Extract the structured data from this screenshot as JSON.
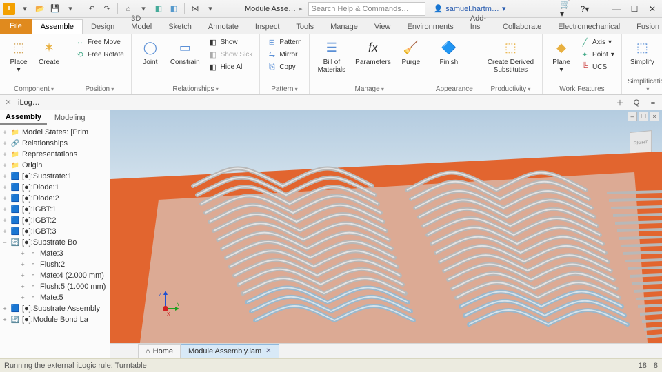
{
  "title": {
    "app_badge": "I",
    "doc": "Module Asse…",
    "search_placeholder": "Search Help & Commands…",
    "user": "samuel.hartm…"
  },
  "tabs": [
    "File",
    "Assemble",
    "Design",
    "3D Model",
    "Sketch",
    "Annotate",
    "Inspect",
    "Tools",
    "Manage",
    "View",
    "Environments",
    "Add-Ins",
    "Collaborate",
    "Electromechanical",
    "Fusion"
  ],
  "ribbon": {
    "component": {
      "title": "Component",
      "place": "Place",
      "create": "Create"
    },
    "position": {
      "title": "Position",
      "free_move": "Free Move",
      "free_rotate": "Free Rotate",
      "joint": "Joint",
      "constrain": "Constrain"
    },
    "relationships": {
      "title": "Relationships",
      "show": "Show",
      "show_sick": "Show Sick",
      "hide_all": "Hide All"
    },
    "pattern": {
      "title": "Pattern",
      "pattern": "Pattern",
      "mirror": "Mirror",
      "copy": "Copy"
    },
    "manage": {
      "title": "Manage",
      "bom": "Bill of\nMaterials",
      "params": "Parameters",
      "purge": "Purge"
    },
    "appearance": {
      "title": "Appearance",
      "finish": "Finish"
    },
    "productivity": {
      "title": "Productivity",
      "cds": "Create Derived\nSubstitutes"
    },
    "workfeat": {
      "title": "Work Features",
      "plane": "Plane",
      "axis": "Axis",
      "point": "Point",
      "ucs": "UCS"
    },
    "simplification": {
      "title": "Simplification",
      "simplify": "Simplify"
    }
  },
  "ilogic": {
    "label": "iLog…"
  },
  "browser": {
    "tabs": {
      "assembly": "Assembly",
      "modeling": "Modeling"
    },
    "items": [
      {
        "t": "Model States: [Prim",
        "k": "fold",
        "i": 0
      },
      {
        "t": "Relationships",
        "k": "rel",
        "i": 0
      },
      {
        "t": "Representations",
        "k": "fold",
        "i": 0
      },
      {
        "t": "Origin",
        "k": "fold",
        "i": 0
      },
      {
        "t": "[●]:Substrate:1",
        "k": "cube",
        "i": 0
      },
      {
        "t": "[●]:Diode:1",
        "k": "cube",
        "i": 0
      },
      {
        "t": "[●]:Diode:2",
        "k": "cube",
        "i": 0
      },
      {
        "t": "[●]:IGBT:1",
        "k": "cube",
        "i": 0
      },
      {
        "t": "[●]:IGBT:2",
        "k": "cube",
        "i": 0
      },
      {
        "t": "[●]:IGBT:3",
        "k": "cube",
        "i": 0
      },
      {
        "t": "[●]:Substrate Bo",
        "k": "sync",
        "i": 0,
        "open": true
      },
      {
        "t": "Mate:3",
        "k": "con",
        "i": 2
      },
      {
        "t": "Flush:2",
        "k": "con",
        "i": 2
      },
      {
        "t": "Mate:4 (2.000 mm)",
        "k": "con",
        "i": 2
      },
      {
        "t": "Flush:5 (1.000 mm)",
        "k": "con",
        "i": 2
      },
      {
        "t": "Mate:5",
        "k": "con",
        "i": 2
      },
      {
        "t": "[●]:Substrate Assembly",
        "k": "cube",
        "i": 0
      },
      {
        "t": "[●]:Module Bond La",
        "k": "sync",
        "i": 0
      }
    ]
  },
  "doctabs": {
    "home": "Home",
    "doc": "Module Assembly.iam"
  },
  "status": {
    "msg": "Running the external iLogic rule: Turntable",
    "n1": "18",
    "n2": "8"
  },
  "viewcube": "RIGHT"
}
